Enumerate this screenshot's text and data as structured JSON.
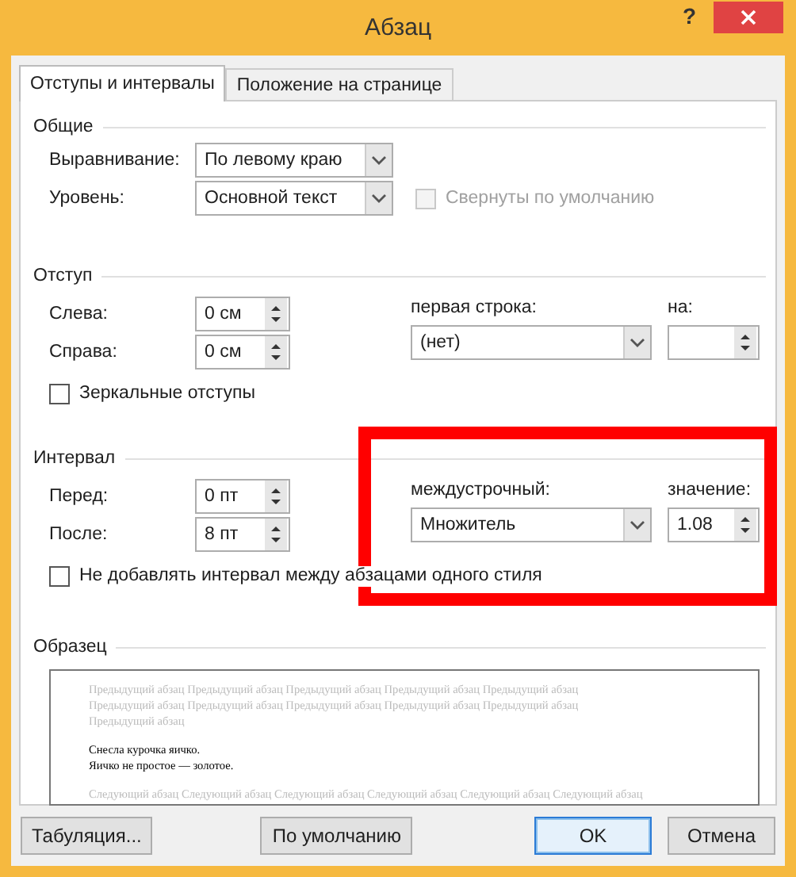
{
  "window": {
    "title": "Абзац",
    "help": "?"
  },
  "tabs": [
    {
      "label": "Отступы и интервалы",
      "selected": true
    },
    {
      "label": "Положение на странице",
      "selected": false
    }
  ],
  "general": {
    "title": "Общие",
    "alignment": {
      "label": "Выравнивание:",
      "value": "По левому краю"
    },
    "level": {
      "label": "Уровень:",
      "value": "Основной текст"
    },
    "collapsed": {
      "label": "Свернуты по умолчанию",
      "checked": false,
      "disabled": true
    }
  },
  "indent": {
    "title": "Отступ",
    "left": {
      "label": "Слева:",
      "value": "0 см"
    },
    "right": {
      "label": "Справа:",
      "value": "0 см"
    },
    "first_line": {
      "label": "первая строка:",
      "value": "(нет)"
    },
    "by": {
      "label": "на:"
    },
    "mirror": {
      "label": "Зеркальные отступы",
      "checked": false,
      "disabled": false
    }
  },
  "spacing": {
    "title": "Интервал",
    "before": {
      "label": "Перед:",
      "value": "0 пт"
    },
    "after": {
      "label": "После:",
      "value": "8 пт"
    },
    "line": {
      "label": "междустрочный:",
      "value": "Множитель"
    },
    "at": {
      "label": "значение:",
      "value": "1.08"
    },
    "dont_add": {
      "label": "Не добавлять интервал между абзацами одного стиля",
      "checked": false,
      "disabled": false
    }
  },
  "preview": {
    "title": "Образец",
    "lines": [
      {
        "kind": "other",
        "text": "Предыдущий абзац Предыдущий абзац Предыдущий абзац Предыдущий абзац Предыдущий абзац"
      },
      {
        "kind": "other",
        "text": "Предыдущий абзац Предыдущий абзац Предыдущий абзац Предыдущий абзац Предыдущий абзац"
      },
      {
        "kind": "other",
        "text": "Предыдущий абзац"
      },
      {
        "kind": "sample",
        "text": "Снесла курочка яичко."
      },
      {
        "kind": "sample",
        "text": "Яичко не простое — золотое."
      },
      {
        "kind": "other",
        "text": "Следующий абзац Следующий абзац Следующий абзац Следующий абзац Следующий абзац Следующий абзац"
      }
    ]
  },
  "buttons": [
    {
      "label": "Табуляция...",
      "default": false
    },
    {
      "label": "По умолчанию",
      "default": false
    },
    {
      "label": "OK",
      "default": true
    },
    {
      "label": "Отмена",
      "default": false
    }
  ]
}
